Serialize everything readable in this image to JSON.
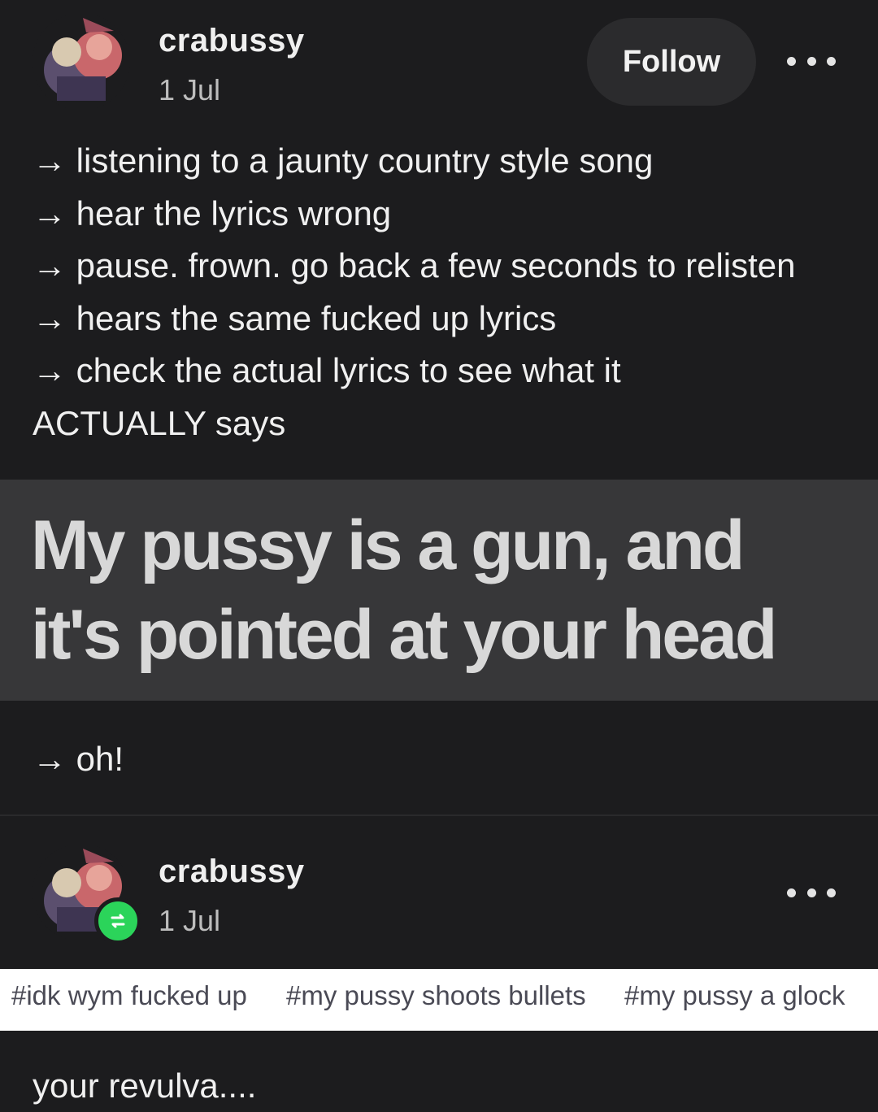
{
  "post1": {
    "username": "crabussy",
    "date": "1 Jul",
    "follow_label": "Follow",
    "lines": [
      "→ listening to a jaunty country style song",
      "→ hear the lyrics wrong",
      "→ pause. frown. go back a few seconds to relisten",
      "→ hears the same fucked up lyrics",
      "→ check the actual lyrics to see what it",
      "ACTUALLY says"
    ],
    "lyric_lines": [
      "My pussy is a gun, and",
      "it's pointed at your head"
    ],
    "after_text": "→ oh!"
  },
  "post2": {
    "username": "crabussy",
    "date": "1 Jul",
    "tags": [
      "#idk wym fucked up",
      "#my pussy shoots bullets",
      "#my pussy a glock"
    ],
    "body": "your revulva...."
  },
  "colors": {
    "background": "#1c1c1e",
    "lyric_box": "#373739",
    "reblog_badge": "#2bd45a",
    "tags_bar": "#ffffff"
  },
  "icons": [
    "avatar",
    "more-icon",
    "reblog-icon"
  ]
}
